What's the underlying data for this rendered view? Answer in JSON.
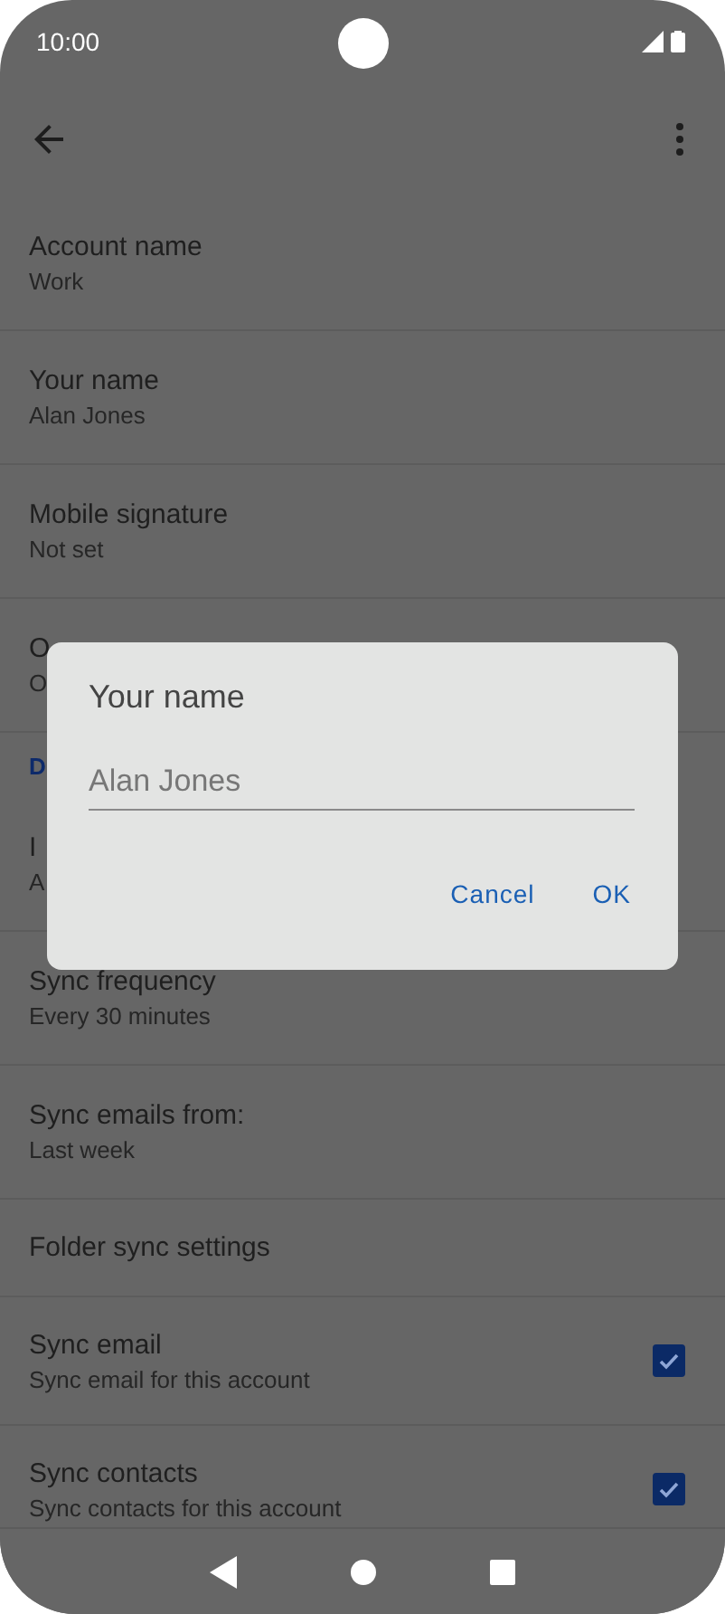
{
  "status_bar": {
    "time": "10:00"
  },
  "settings": [
    {
      "kind": "setting",
      "title": "Account name",
      "summary": "Work"
    },
    {
      "kind": "setting",
      "title": "Your name",
      "summary": "Alan Jones"
    },
    {
      "kind": "setting",
      "title": "Mobile signature",
      "summary": "Not set"
    },
    {
      "kind": "setting",
      "title": "O",
      "summary": "O"
    },
    {
      "kind": "header",
      "title": "D"
    },
    {
      "kind": "setting",
      "title": "I",
      "summary": "A"
    },
    {
      "kind": "setting",
      "title": "Sync frequency",
      "summary": "Every 30 minutes"
    },
    {
      "kind": "setting",
      "title": "Sync emails from:",
      "summary": "Last week"
    },
    {
      "kind": "single",
      "title": "Folder sync settings"
    },
    {
      "kind": "checkbox",
      "title": "Sync email",
      "summary": "Sync email for this account",
      "checked": true
    },
    {
      "kind": "checkbox",
      "title": "Sync contacts",
      "summary": "Sync contacts for this account",
      "checked": true
    }
  ],
  "dialog": {
    "title": "Your name",
    "value": "Alan Jones",
    "buttons": [
      "Cancel",
      "OK"
    ]
  }
}
